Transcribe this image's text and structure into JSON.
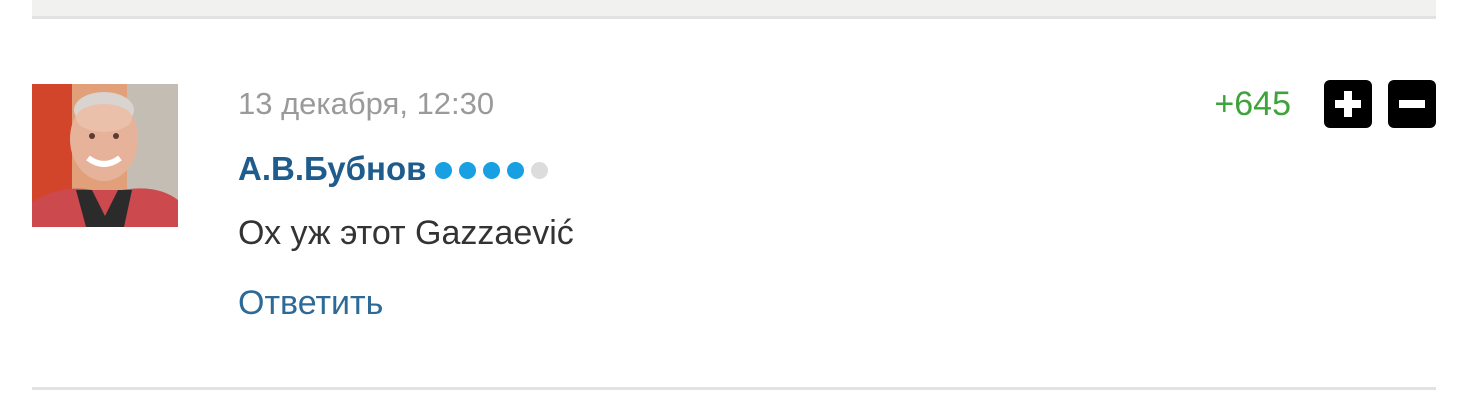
{
  "comment": {
    "timestamp": "13 декабря, 12:30",
    "author": "А.В.Бубнов",
    "author_level_dots": {
      "filled": 4,
      "total": 5
    },
    "text": "Ох уж этот Gazzaević",
    "reply_label": "Ответить",
    "score": "+645",
    "avatar_icon": "user-avatar-photo",
    "upvote_icon": "plus-icon",
    "downvote_icon": "minus-icon"
  },
  "colors": {
    "author": "#1e5c8d",
    "score_positive": "#3fa33c",
    "rating_dot": "#18a0e2",
    "rating_dot_empty": "#dcdcdc",
    "reply_link": "#2d6a98",
    "vote_button_bg": "#000000"
  }
}
